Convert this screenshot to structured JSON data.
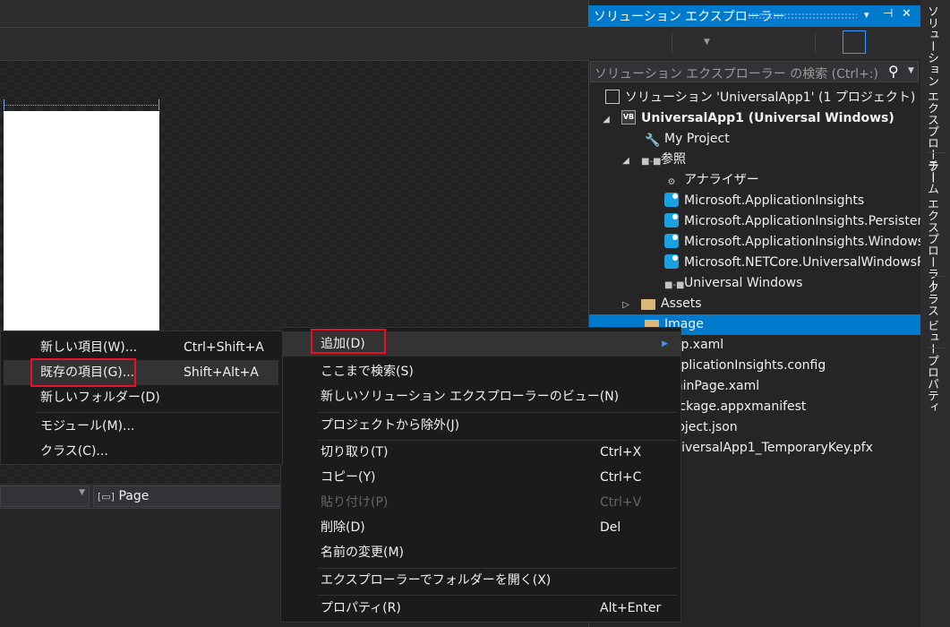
{
  "designer": {
    "page_combo_label": "Page"
  },
  "solution_explorer": {
    "title": "ソリューション エクスプローラー",
    "title_buttons": [
      "▾",
      "⊣",
      "✕"
    ],
    "search_placeholder": "ソリューション エクスプローラー の検索 (Ctrl+:)",
    "tree": [
      {
        "label": "ソリューション 'UniversalApp1' (1 プロジェクト)",
        "icon": "solution-icon"
      },
      {
        "label": "UniversalApp1 (Universal Windows)",
        "icon": "vb-project-icon",
        "expanded": true,
        "bold": true
      },
      {
        "label": "My Project",
        "icon": "wrench-icon"
      },
      {
        "label": "参照",
        "icon": "references-icon",
        "expanded": true
      },
      {
        "label": "アナライザー",
        "icon": "analyzer-icon"
      },
      {
        "label": "Microsoft.ApplicationInsights",
        "icon": "package-icon"
      },
      {
        "label": "Microsoft.ApplicationInsights.PersistenceChannel",
        "icon": "package-icon"
      },
      {
        "label": "Microsoft.ApplicationInsights.WindowsApps",
        "icon": "package-icon"
      },
      {
        "label": "Microsoft.NETCore.UniversalWindowsPlatform",
        "icon": "package-icon"
      },
      {
        "label": "Universal Windows",
        "icon": "reference-icon"
      },
      {
        "label": "Assets",
        "icon": "folder-icon",
        "expanded": false
      },
      {
        "label": "Image",
        "icon": "folder-icon",
        "selected": true
      },
      {
        "label": "App.xaml"
      },
      {
        "label": "ApplicationInsights.config"
      },
      {
        "label": "MainPage.xaml"
      },
      {
        "label": "Package.appxmanifest"
      },
      {
        "label": "project.json"
      },
      {
        "label": "UniversalApp1_TemporaryKey.pfx"
      }
    ]
  },
  "side_tabs": [
    "ソリューション エクスプローラー",
    "チーム エクスプローラー",
    "クラス ビュー",
    "プロパティ"
  ],
  "context_menu": {
    "items": [
      {
        "label": "追加(D)",
        "submenu": true
      },
      {
        "label": "ここまで検索(S)"
      },
      {
        "label": "新しいソリューション エクスプローラーのビュー(N)"
      },
      {
        "label": "プロジェクトから除外(J)"
      },
      {
        "label": "切り取り(T)",
        "shortcut": "Ctrl+X"
      },
      {
        "label": "コピー(Y)",
        "shortcut": "Ctrl+C"
      },
      {
        "label": "貼り付け(P)",
        "shortcut": "Ctrl+V",
        "disabled": true
      },
      {
        "label": "削除(D)",
        "shortcut": "Del"
      },
      {
        "label": "名前の変更(M)"
      },
      {
        "label": "エクスプローラーでフォルダーを開く(X)"
      },
      {
        "label": "プロパティ(R)",
        "shortcut": "Alt+Enter"
      }
    ]
  },
  "add_submenu": {
    "items": [
      {
        "label": "新しい項目(W)...",
        "shortcut": "Ctrl+Shift+A"
      },
      {
        "label": "既存の項目(G)...",
        "shortcut": "Shift+Alt+A"
      },
      {
        "label": "新しいフォルダー(D)"
      },
      {
        "label": "モジュール(M)..."
      },
      {
        "label": "クラス(C)..."
      }
    ]
  },
  "colors": {
    "accent": "#007acc",
    "highlight_box": "#e81123"
  }
}
